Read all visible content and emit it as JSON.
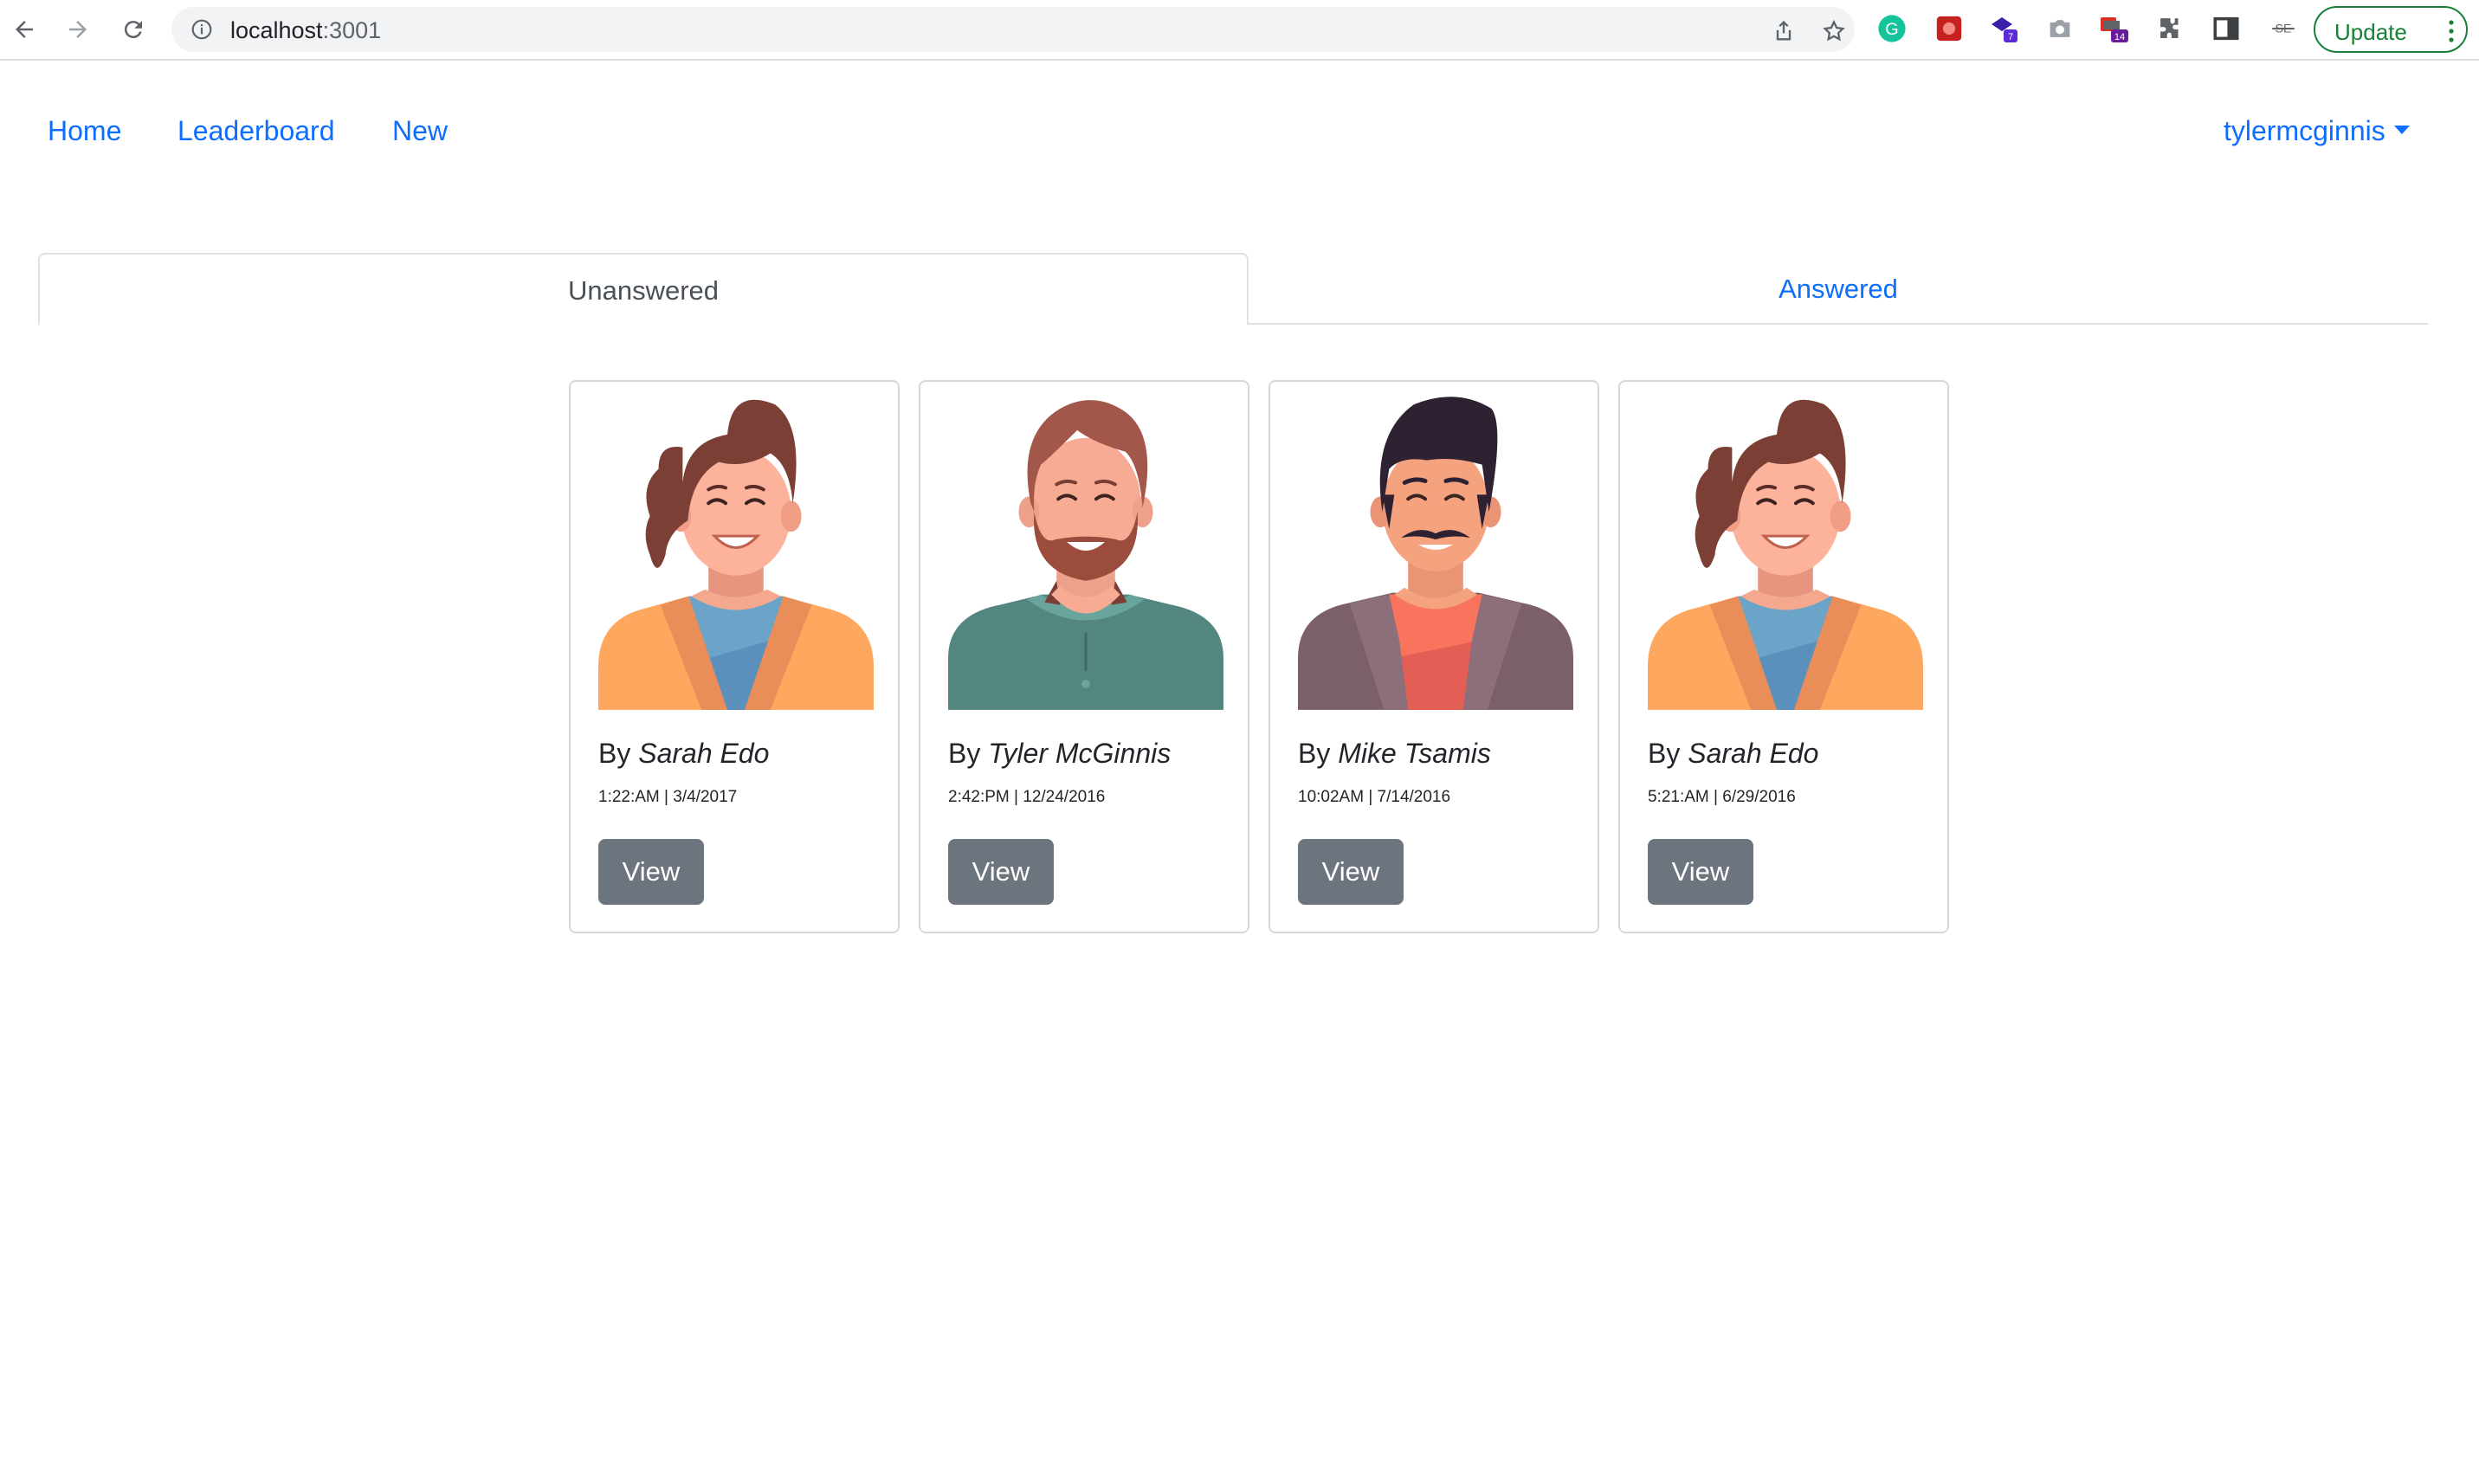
{
  "browser": {
    "url_host": "localhost",
    "url_port": ":3001",
    "update_label": "Update",
    "badges": {
      "ext_a": "7",
      "ext_b": "14"
    }
  },
  "nav": {
    "links": [
      "Home",
      "Leaderboard",
      "New"
    ],
    "user": "tylermcginnis"
  },
  "tabs": {
    "unanswered": "Unanswered",
    "answered": "Answered",
    "active": "unanswered"
  },
  "cards": [
    {
      "by": "By",
      "author": "Sarah Edo",
      "timestamp": "1:22:AM | 3/4/2017",
      "button": "View",
      "avatar": "woman-avatar"
    },
    {
      "by": "By",
      "author": "Tyler McGinnis",
      "timestamp": "2:42:PM | 12/24/2016",
      "button": "View",
      "avatar": "bearded-man-avatar"
    },
    {
      "by": "By",
      "author": "Mike Tsamis",
      "timestamp": "10:02AM | 7/14/2016",
      "button": "View",
      "avatar": "mustache-man-avatar"
    },
    {
      "by": "By",
      "author": "Sarah Edo",
      "timestamp": "5:21:AM | 6/29/2016",
      "button": "View",
      "avatar": "woman-avatar"
    }
  ],
  "colors": {
    "link": "#0d6efd",
    "button_bg": "#6c757d",
    "border": "#dee2e6",
    "update_green": "#188038"
  }
}
